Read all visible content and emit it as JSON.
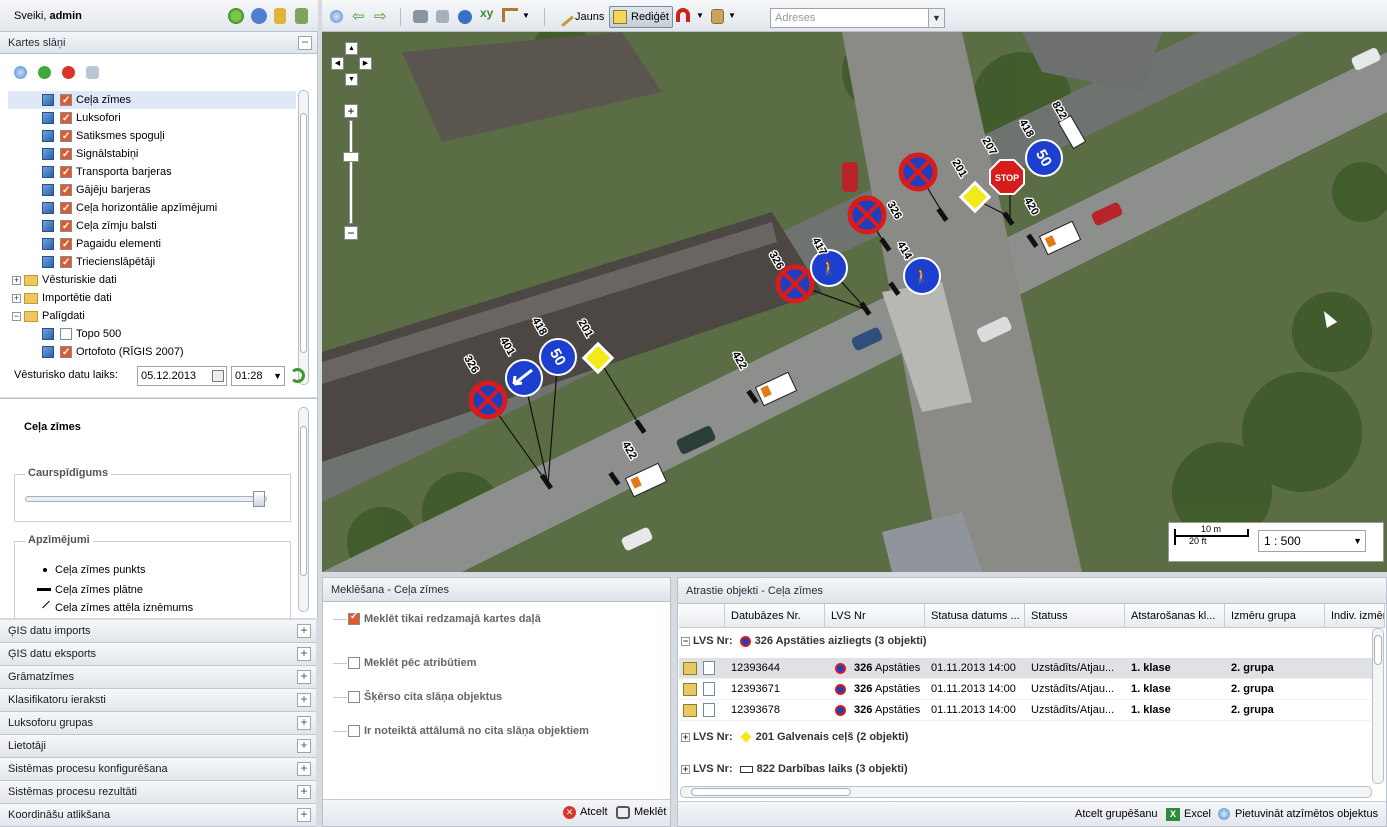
{
  "header": {
    "greeting_prefix": "Sveiki,",
    "user": "admin"
  },
  "map_toolbar": {
    "new_label": "Jauns",
    "edit_label": "Rediģēt",
    "address_placeholder": "Adreses"
  },
  "layers_panel": {
    "title": "Kartes slāņi",
    "layers": [
      "Ceļa zīmes",
      "Luksofori",
      "Satiksmes spoguļi",
      "Signālstabiņi",
      "Transporta barjeras",
      "Gājēju barjeras",
      "Ceļa horizontālie apzīmējumi",
      "Ceļa zīmju balsti",
      "Pagaidu elementi",
      "Triecienslāpētāji"
    ],
    "groups": [
      "Vēsturiskie dati",
      "Importētie dati",
      "Palīgdati"
    ],
    "sublayers": [
      "Topo 500",
      "Ortofoto (RĪGIS 2007)"
    ],
    "hist_label": "Vēsturisko datu laiks:",
    "hist_date": "05.12.2013",
    "hist_time": "01:28"
  },
  "legend_panel": {
    "title": "Ceļa zīmes",
    "opacity_label": "Caurspīdīgums",
    "legend_label": "Apzīmējumi",
    "items": [
      "Ceļa zīmes punkts",
      "Ceļa zīmes plātne",
      "Ceļa zīmes attēla izņēmums"
    ]
  },
  "side_sections": [
    "ĢIS datu imports",
    "ĢIS datu eksports",
    "Grāmatzīmes",
    "Klasifikatoru ieraksti",
    "Luksoforu grupas",
    "Lietotāji",
    "Sistēmas procesu konfigurēšana",
    "Sistēmas procesu rezultāti",
    "Koordināšu atlikšana"
  ],
  "search_panel": {
    "title": "Meklēšana - Ceļa zīmes",
    "options": [
      "Meklēt tikai redzamajā kartes daļā",
      "Meklēt pēc atribūtiem",
      "Šķērso cita slāņa objektus",
      "Ir noteiktā attālumā no cita slāņa objektiem"
    ],
    "cancel": "Atcelt",
    "search": "Meklēt"
  },
  "results_panel": {
    "title": "Atrastie objekti - Ceļa zīmes",
    "columns": [
      "Datubāzes Nr.",
      "LVS Nr",
      "Statusa datums ...",
      "Statuss",
      "Atstarošanas kl...",
      "Izmēru grupa",
      "Indiv. izmēr"
    ],
    "groups": [
      {
        "label": "LVS Nr:",
        "text": "326 Apstāties aizliegts (3 objekti)"
      },
      {
        "label": "LVS Nr:",
        "text": "201 Galvenais ceļš (2 objekti)"
      },
      {
        "label": "LVS Nr:",
        "text": "822 Darbības laiks (3 objekti)"
      }
    ],
    "rows": [
      {
        "db": "12393644",
        "lvs_num": "326",
        "lvs_name": "Apstāties",
        "date": "01.11.2013 14:00",
        "status": "Uzstādīts/Atjau...",
        "class": "1. klase",
        "size": "2. grupa"
      },
      {
        "db": "12393671",
        "lvs_num": "326",
        "lvs_name": "Apstāties",
        "date": "01.11.2013 14:00",
        "status": "Uzstādīts/Atjau...",
        "class": "1. klase",
        "size": "2. grupa"
      },
      {
        "db": "12393678",
        "lvs_num": "326",
        "lvs_name": "Apstāties",
        "date": "01.11.2013 14:00",
        "status": "Uzstādīts/Atjau...",
        "class": "1. klase",
        "size": "2. grupa"
      }
    ],
    "footer": {
      "ungroup": "Atcelt grupēšanu",
      "excel": "Excel",
      "zoom": "Pietuvināt atzīmētos objektus"
    }
  },
  "scale": {
    "m": "10 m",
    "ft": "20 ft",
    "ratio": "1 : 500"
  },
  "map_labels": [
    "326",
    "417",
    "414",
    "326",
    "201",
    "207",
    "418",
    "822",
    "420",
    "326",
    "401",
    "418",
    "201",
    "422",
    "422"
  ]
}
